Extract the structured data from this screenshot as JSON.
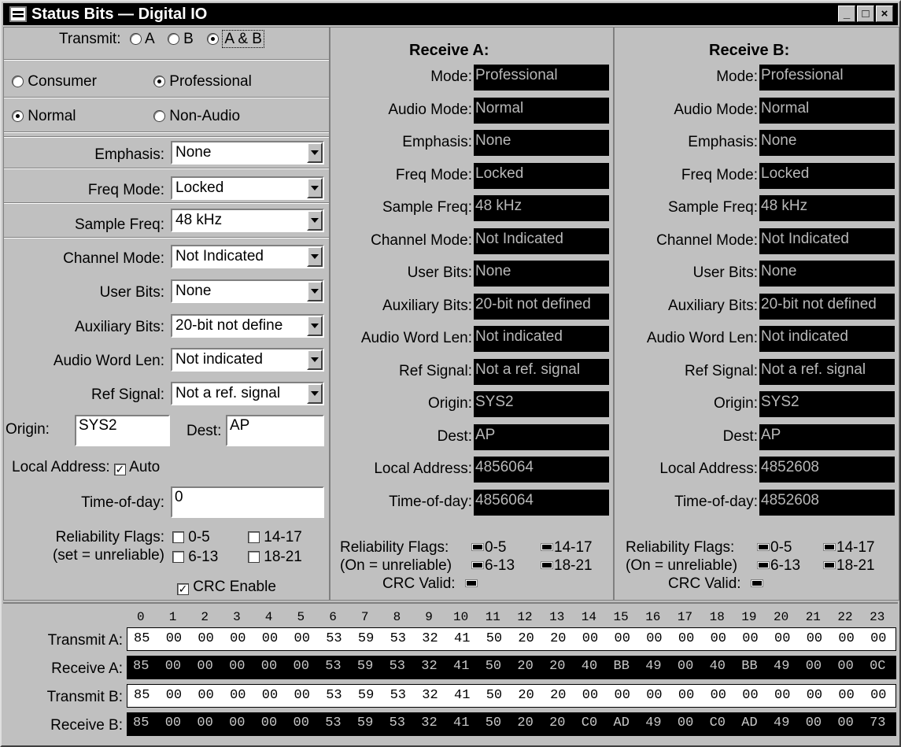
{
  "window": {
    "title": "Status Bits — Digital IO",
    "buttons": {
      "min": "_",
      "max": "□",
      "close": "×"
    }
  },
  "transmit": {
    "label": "Transmit:",
    "options": [
      "A",
      "B",
      "A & B"
    ],
    "selected": "A & B",
    "mode_options": [
      "Consumer",
      "Professional"
    ],
    "mode_selected": "Professional",
    "audio_options": [
      "Normal",
      "Non-Audio"
    ],
    "audio_selected": "Normal",
    "emphasis": {
      "label": "Emphasis:",
      "value": "None"
    },
    "freq_mode": {
      "label": "Freq Mode:",
      "value": "Locked"
    },
    "sample_freq": {
      "label": "Sample Freq:",
      "value": "48 kHz"
    },
    "channel_mode": {
      "label": "Channel Mode:",
      "value": "Not Indicated"
    },
    "user_bits": {
      "label": "User Bits:",
      "value": "None"
    },
    "aux_bits": {
      "label": "Auxiliary Bits:",
      "value": "20-bit not define"
    },
    "word_len": {
      "label": "Audio Word Len:",
      "value": "Not indicated"
    },
    "ref_signal": {
      "label": "Ref Signal:",
      "value": "Not a ref. signal"
    },
    "origin": {
      "label": "Origin:",
      "value": "SYS2"
    },
    "dest": {
      "label": "Dest:",
      "value": "AP"
    },
    "local_address": {
      "label": "Local Address:",
      "auto_label": "Auto",
      "auto_checked": true
    },
    "time_of_day": {
      "label": "Time-of-day:",
      "value": "0"
    },
    "reliability": {
      "label1": "Reliability Flags:",
      "label2": "(set = unreliable)",
      "flags": [
        "0-5",
        "14-17",
        "6-13",
        "18-21"
      ]
    },
    "crc": {
      "label": "CRC Enable",
      "checked": true
    }
  },
  "receive_a": {
    "title": "Receive A:",
    "fields": [
      {
        "label": "Mode:",
        "value": "Professional"
      },
      {
        "label": "Audio Mode:",
        "value": "Normal"
      },
      {
        "label": "Emphasis:",
        "value": "None"
      },
      {
        "label": "Freq Mode:",
        "value": "Locked"
      },
      {
        "label": "Sample Freq:",
        "value": "48 kHz"
      },
      {
        "label": "Channel Mode:",
        "value": "Not Indicated"
      },
      {
        "label": "User Bits:",
        "value": "None"
      },
      {
        "label": "Auxiliary Bits:",
        "value": "20-bit not defined"
      },
      {
        "label": "Audio Word Len:",
        "value": "Not indicated"
      },
      {
        "label": "Ref Signal:",
        "value": "Not a ref. signal"
      },
      {
        "label": "Origin:",
        "value": "SYS2"
      },
      {
        "label": "Dest:",
        "value": "AP"
      },
      {
        "label": "Local Address:",
        "value": "4856064"
      },
      {
        "label": "Time-of-day:",
        "value": "4856064"
      }
    ],
    "reliability": {
      "label1": "Reliability Flags:",
      "label2": "(On = unreliable)",
      "flags": [
        "0-5",
        "14-17",
        "6-13",
        "18-21"
      ]
    },
    "crc_label": "CRC Valid:"
  },
  "receive_b": {
    "title": "Receive B:",
    "fields": [
      {
        "label": "Mode:",
        "value": "Professional"
      },
      {
        "label": "Audio Mode:",
        "value": "Normal"
      },
      {
        "label": "Emphasis:",
        "value": "None"
      },
      {
        "label": "Freq Mode:",
        "value": "Locked"
      },
      {
        "label": "Sample Freq:",
        "value": "48 kHz"
      },
      {
        "label": "Channel Mode:",
        "value": "Not Indicated"
      },
      {
        "label": "User Bits:",
        "value": "None"
      },
      {
        "label": "Auxiliary Bits:",
        "value": "20-bit not defined"
      },
      {
        "label": "Audio Word Len:",
        "value": "Not indicated"
      },
      {
        "label": "Ref Signal:",
        "value": "Not a ref. signal"
      },
      {
        "label": "Origin:",
        "value": "SYS2"
      },
      {
        "label": "Dest:",
        "value": "AP"
      },
      {
        "label": "Local Address:",
        "value": "4852608"
      },
      {
        "label": "Time-of-day:",
        "value": "4852608"
      }
    ],
    "reliability": {
      "label1": "Reliability Flags:",
      "label2": "(On = unreliable)",
      "flags": [
        "0-5",
        "14-17",
        "6-13",
        "18-21"
      ]
    },
    "crc_label": "CRC Valid:"
  },
  "hex": {
    "columns": [
      "0",
      "1",
      "2",
      "3",
      "4",
      "5",
      "6",
      "7",
      "8",
      "9",
      "10",
      "11",
      "12",
      "13",
      "14",
      "15",
      "16",
      "17",
      "18",
      "19",
      "20",
      "21",
      "22",
      "23"
    ],
    "rows": [
      {
        "label": "Transmit A:",
        "style": "white",
        "bytes": [
          "85",
          "00",
          "00",
          "00",
          "00",
          "00",
          "53",
          "59",
          "53",
          "32",
          "41",
          "50",
          "20",
          "20",
          "00",
          "00",
          "00",
          "00",
          "00",
          "00",
          "00",
          "00",
          "00",
          "00"
        ]
      },
      {
        "label": "Receive A:",
        "style": "black",
        "bytes": [
          "85",
          "00",
          "00",
          "00",
          "00",
          "00",
          "53",
          "59",
          "53",
          "32",
          "41",
          "50",
          "20",
          "20",
          "40",
          "BB",
          "49",
          "00",
          "40",
          "BB",
          "49",
          "00",
          "00",
          "0C"
        ]
      },
      {
        "label": "Transmit B:",
        "style": "white",
        "bytes": [
          "85",
          "00",
          "00",
          "00",
          "00",
          "00",
          "53",
          "59",
          "53",
          "32",
          "41",
          "50",
          "20",
          "20",
          "00",
          "00",
          "00",
          "00",
          "00",
          "00",
          "00",
          "00",
          "00",
          "00"
        ]
      },
      {
        "label": "Receive B:",
        "style": "black",
        "bytes": [
          "85",
          "00",
          "00",
          "00",
          "00",
          "00",
          "53",
          "59",
          "53",
          "32",
          "41",
          "50",
          "20",
          "20",
          "C0",
          "AD",
          "49",
          "00",
          "C0",
          "AD",
          "49",
          "00",
          "00",
          "73"
        ]
      }
    ]
  }
}
